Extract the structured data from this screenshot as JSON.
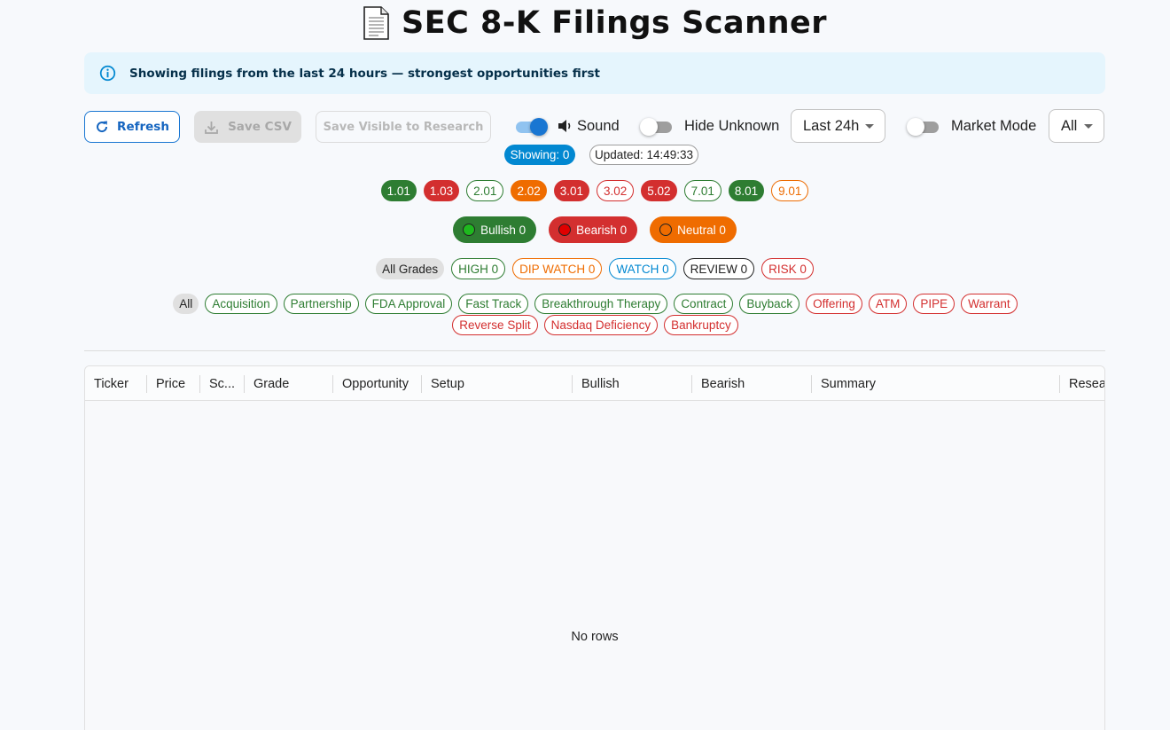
{
  "header": {
    "title": "SEC 8-K Filings Scanner",
    "icon": "document-icon"
  },
  "banner": {
    "icon": "info-icon",
    "text": "Showing filings from the last 24 hours — strongest opportunities first"
  },
  "toolbar": {
    "refresh_label": "Refresh",
    "save_csv_label": "Save CSV",
    "save_research_label": "Save Visible to Research",
    "sound": {
      "label": "Sound",
      "enabled": true,
      "icon": "speaker-icon"
    },
    "hide_unknown": {
      "label": "Hide Unknown",
      "enabled": false
    },
    "time_range": {
      "value": "Last 24h"
    },
    "market_mode": {
      "label": "Market Mode",
      "enabled": false
    },
    "market_filter": {
      "value": "All"
    }
  },
  "status": {
    "showing": "Showing: 0",
    "updated": "Updated: 14:49:33"
  },
  "item_filters": [
    {
      "label": "1.01",
      "style": "f-green"
    },
    {
      "label": "1.03",
      "style": "f-red"
    },
    {
      "label": "2.01",
      "style": "o-green"
    },
    {
      "label": "2.02",
      "style": "f-orange"
    },
    {
      "label": "3.01",
      "style": "f-red"
    },
    {
      "label": "3.02",
      "style": "o-red"
    },
    {
      "label": "5.02",
      "style": "f-red"
    },
    {
      "label": "7.01",
      "style": "o-green"
    },
    {
      "label": "8.01",
      "style": "f-green"
    },
    {
      "label": "9.01",
      "style": "o-gold"
    }
  ],
  "sentiment": [
    {
      "label": "Bullish 0",
      "color": "#2e7d32",
      "dot": "#1eb91e"
    },
    {
      "label": "Bearish 0",
      "color": "#d32f2f",
      "dot": "#e00000"
    },
    {
      "label": "Neutral 0",
      "color": "#ef6c00",
      "dot": "#ef6c00"
    }
  ],
  "grades": [
    {
      "label": "All Grades",
      "style": "f-grey"
    },
    {
      "label": "HIGH 0",
      "style": "o-green"
    },
    {
      "label": "DIP WATCH 0",
      "style": "o-orange"
    },
    {
      "label": "WATCH 0",
      "style": "o-blue"
    },
    {
      "label": "REVIEW 0",
      "style": "o-dark"
    },
    {
      "label": "RISK 0",
      "style": "o-red"
    }
  ],
  "categories": [
    {
      "label": "All",
      "style": "f-grey"
    },
    {
      "label": "Acquisition",
      "style": "o-green"
    },
    {
      "label": "Partnership",
      "style": "o-green"
    },
    {
      "label": "FDA Approval",
      "style": "o-green"
    },
    {
      "label": "Fast Track",
      "style": "o-green"
    },
    {
      "label": "Breakthrough Therapy",
      "style": "o-green"
    },
    {
      "label": "Contract",
      "style": "o-green"
    },
    {
      "label": "Buyback",
      "style": "o-green"
    },
    {
      "label": "Offering",
      "style": "o-red"
    },
    {
      "label": "ATM",
      "style": "o-red"
    },
    {
      "label": "PIPE",
      "style": "o-red"
    },
    {
      "label": "Warrant",
      "style": "o-red"
    },
    {
      "label": "Reverse Split",
      "style": "o-red"
    },
    {
      "label": "Nasdaq Deficiency",
      "style": "o-red"
    },
    {
      "label": "Bankruptcy",
      "style": "o-red"
    }
  ],
  "table": {
    "columns": [
      "Ticker",
      "Price",
      "Sc...",
      "Grade",
      "Opportunity",
      "Setup",
      "Bullish",
      "Bearish",
      "Summary",
      "Resea"
    ],
    "empty_text": "No rows"
  },
  "colors": {
    "accent": "#1976d2",
    "bullish": "#2e7d32",
    "bearish": "#d32f2f",
    "neutral": "#ef6c00",
    "banner_bg": "#e5f5fd"
  }
}
